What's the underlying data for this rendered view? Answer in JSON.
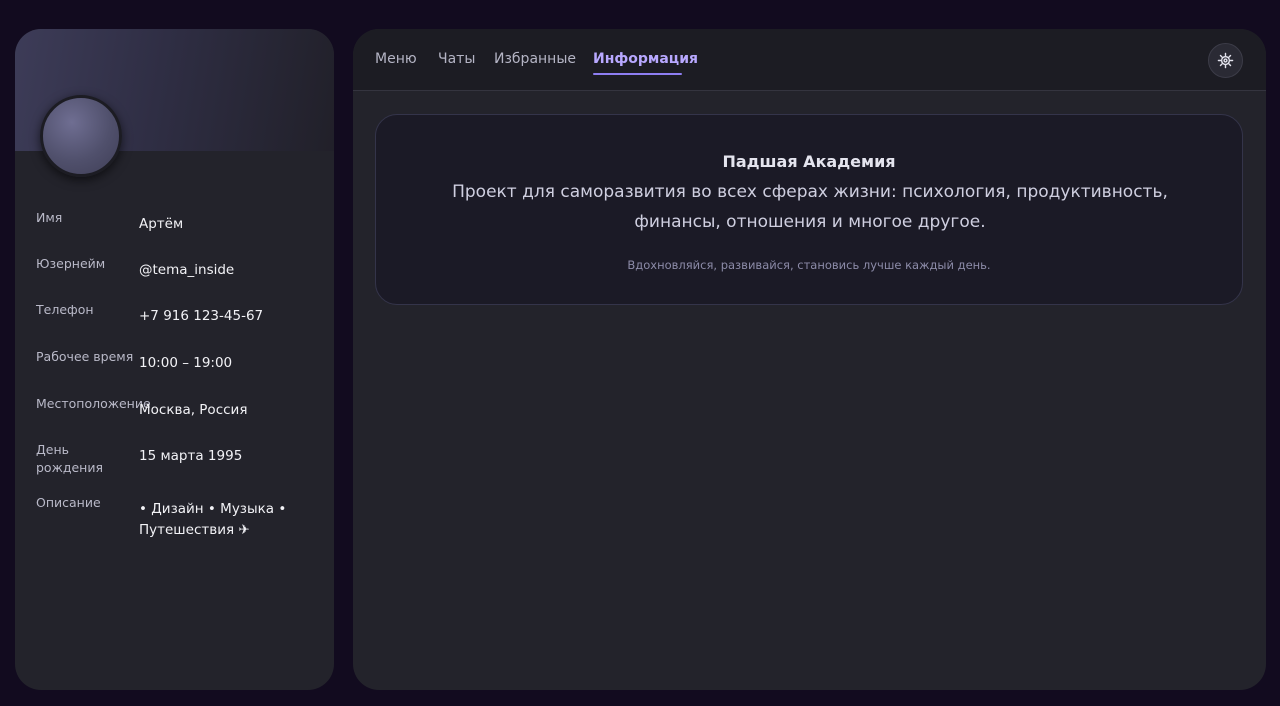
{
  "profile": {
    "fields": [
      {
        "label": "Имя",
        "value": "Артём"
      },
      {
        "label": "Юзернейм",
        "value": "@tema_inside"
      },
      {
        "label": "Телефон",
        "value": "+7 916 123-45-67"
      },
      {
        "label": "Рабочее время",
        "value": "10:00 – 19:00"
      },
      {
        "label": "Местоположение",
        "value": "Москва, Россия"
      },
      {
        "label": "День рождения",
        "value": "15 марта 1995"
      },
      {
        "label": "Описание",
        "value": "• Дизайн • Музыка • Путешествия ✈"
      }
    ]
  },
  "tabs": [
    {
      "label": "Меню"
    },
    {
      "label": "Чаты"
    },
    {
      "label": "Избранные"
    },
    {
      "label": "Информация",
      "active": true
    }
  ],
  "settings_icon": "gear-icon",
  "card": {
    "title": "Падшая Академия",
    "description": "Проект для саморазвития во всех сферах жизни: психология, продуктивность, финансы, отношения и многое другое.",
    "tagline": "Вдохновляйся, развивайся, становись лучше каждый день."
  },
  "colors": {
    "accent": "#8e7ef2",
    "background": "#120b1f",
    "panel": "#23232b"
  }
}
